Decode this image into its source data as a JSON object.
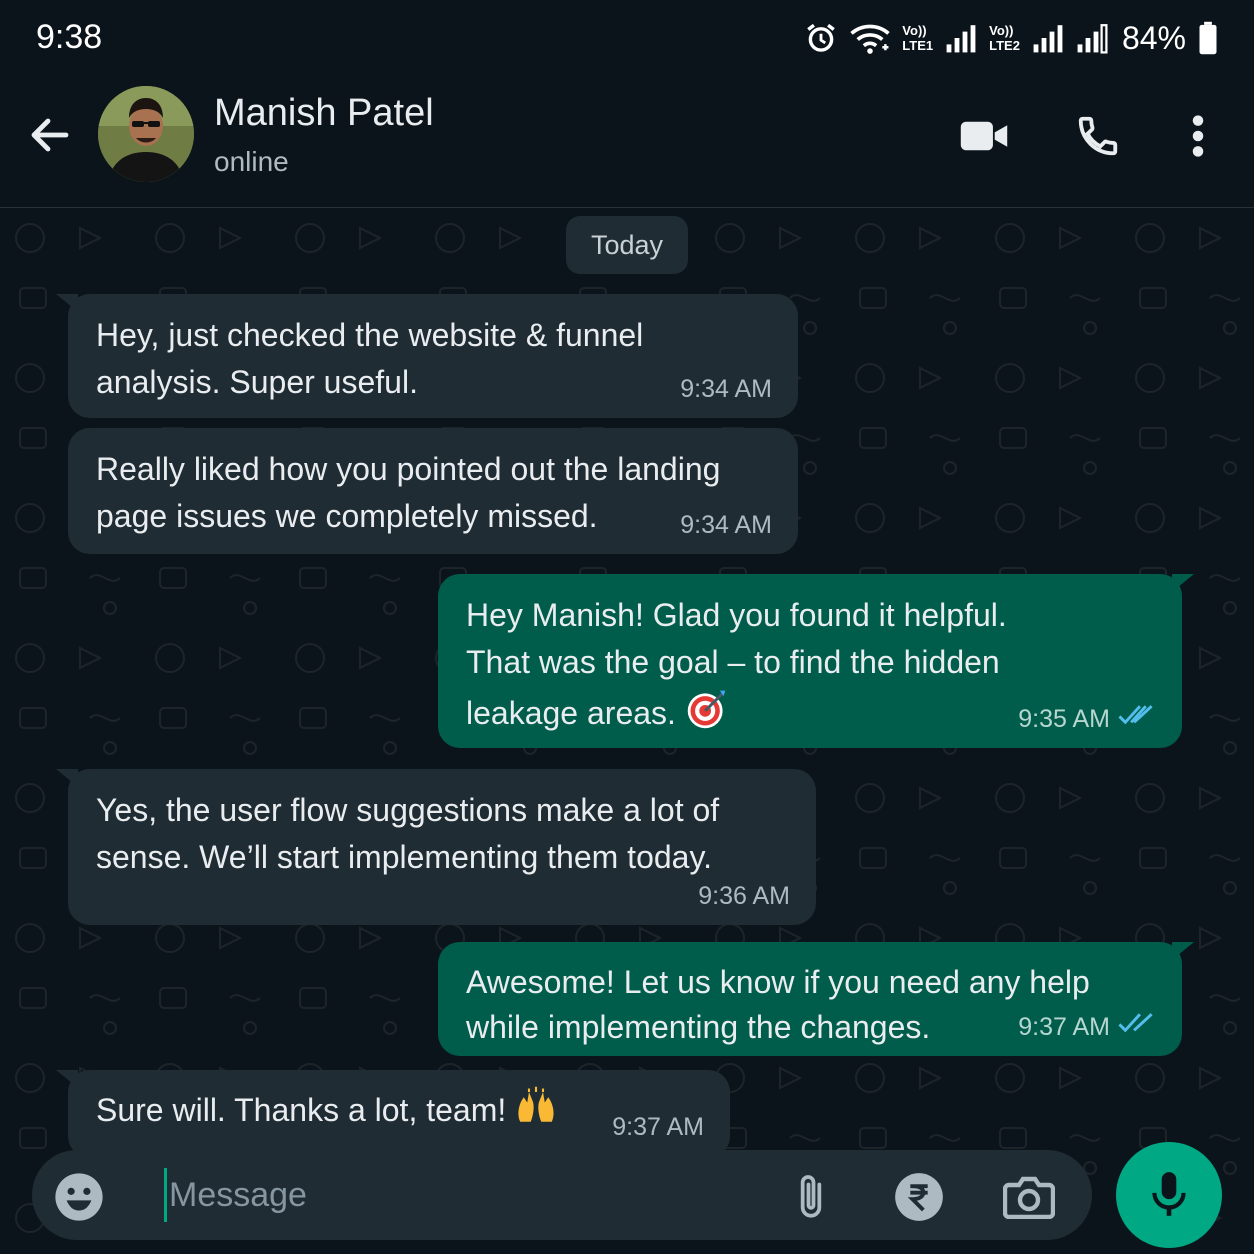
{
  "status_bar": {
    "time": "9:38",
    "sim1_label_top": "Vo))",
    "sim1_label_bottom": "LTE1",
    "sim2_label_top": "Vo))",
    "sim2_label_bottom": "LTE2",
    "battery": "84%",
    "icons": [
      "alarm-icon",
      "wifi-icon",
      "signal-icon",
      "signal-icon",
      "signal-icon",
      "battery-icon"
    ]
  },
  "header": {
    "contact_name": "Manish Patel",
    "contact_status": "online",
    "icons": [
      "back-arrow-icon",
      "video-call-icon",
      "phone-icon",
      "more-vert-icon"
    ]
  },
  "chat": {
    "date_chip": "Today",
    "messages": [
      {
        "direction": "in",
        "text": "Hey, just checked the website & funnel\nanalysis. Super useful.",
        "time": "9:34 AM"
      },
      {
        "direction": "in",
        "text": "Really liked how you pointed out the landing\npage issues we completely missed.",
        "time": "9:34 AM"
      },
      {
        "direction": "out",
        "text": "Hey Manish! Glad you found it helpful.\nThat was the goal – to find the hidden\nleakage areas.",
        "emoji": "direct-hit-emoji",
        "time": "9:35 AM",
        "read": true
      },
      {
        "direction": "in",
        "text": "Yes, the user flow suggestions make a lot of\nsense. We’ll start implementing them today.",
        "time": "9:36 AM"
      },
      {
        "direction": "out",
        "text": "Awesome! Let us know if you need any help\nwhile implementing the changes.",
        "time": "9:37 AM",
        "read": true
      },
      {
        "direction": "in",
        "text": "Sure will. Thanks a lot, team!",
        "emoji": "raising-hands-emoji",
        "time": "9:37 AM"
      }
    ]
  },
  "composer": {
    "placeholder": "Message",
    "icons": [
      "emoji-icon",
      "attach-icon",
      "rupee-icon",
      "camera-icon",
      "mic-icon"
    ]
  },
  "colors": {
    "background": "#0b141a",
    "incoming_bubble": "#202c33",
    "outgoing_bubble": "#005c4b",
    "accent": "#00a884",
    "read_ticks": "#53bdeb"
  }
}
